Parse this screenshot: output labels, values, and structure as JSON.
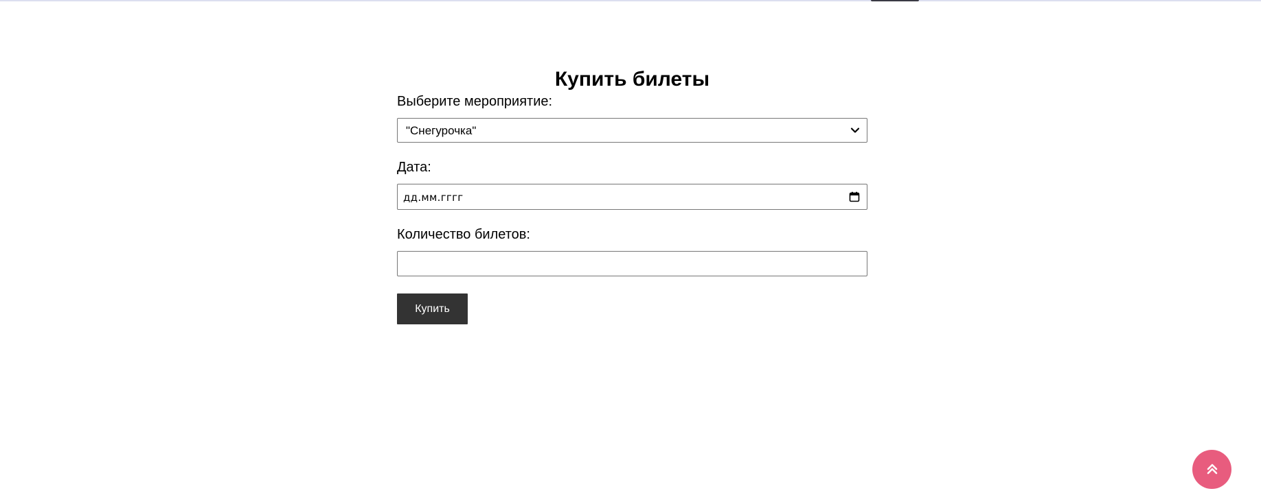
{
  "page": {
    "title": "Купить билеты"
  },
  "form": {
    "event_label": "Выберите мероприятие:",
    "event_selected": "\"Снегурочка\"",
    "date_label": "Дата:",
    "date_placeholder": "дд.мм.гггг",
    "quantity_label": "Количество билетов:",
    "quantity_value": "",
    "submit_label": "Купить"
  },
  "icons": {
    "select": "chevron-down-icon",
    "date": "calendar-icon",
    "scroll_top": "double-chevron-up-icon"
  },
  "colors": {
    "button_bg": "#333333",
    "button_text": "#ffffff",
    "scroll_top_bg": "#e85c7e",
    "input_border": "#767676"
  }
}
